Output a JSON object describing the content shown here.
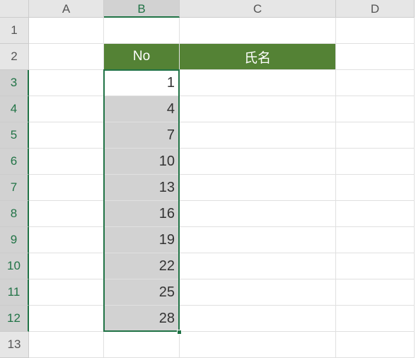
{
  "columns": [
    "A",
    "B",
    "C",
    "D"
  ],
  "rows": [
    "1",
    "2",
    "3",
    "4",
    "5",
    "6",
    "7",
    "8",
    "9",
    "10",
    "11",
    "12",
    "13"
  ],
  "headers": {
    "b2": "No",
    "c2": "氏名"
  },
  "values": {
    "b3": "1",
    "b4": "4",
    "b5": "7",
    "b6": "10",
    "b7": "13",
    "b8": "16",
    "b9": "19",
    "b10": "22",
    "b11": "25",
    "b12": "28"
  },
  "chart_data": {
    "type": "table",
    "title": "",
    "columns": [
      "No",
      "氏名"
    ],
    "rows": [
      [
        1,
        ""
      ],
      [
        4,
        ""
      ],
      [
        7,
        ""
      ],
      [
        10,
        ""
      ],
      [
        13,
        ""
      ],
      [
        16,
        ""
      ],
      [
        19,
        ""
      ],
      [
        22,
        ""
      ],
      [
        25,
        ""
      ],
      [
        28,
        ""
      ]
    ]
  },
  "selection": {
    "range": "B3:B12",
    "active": "B3"
  }
}
